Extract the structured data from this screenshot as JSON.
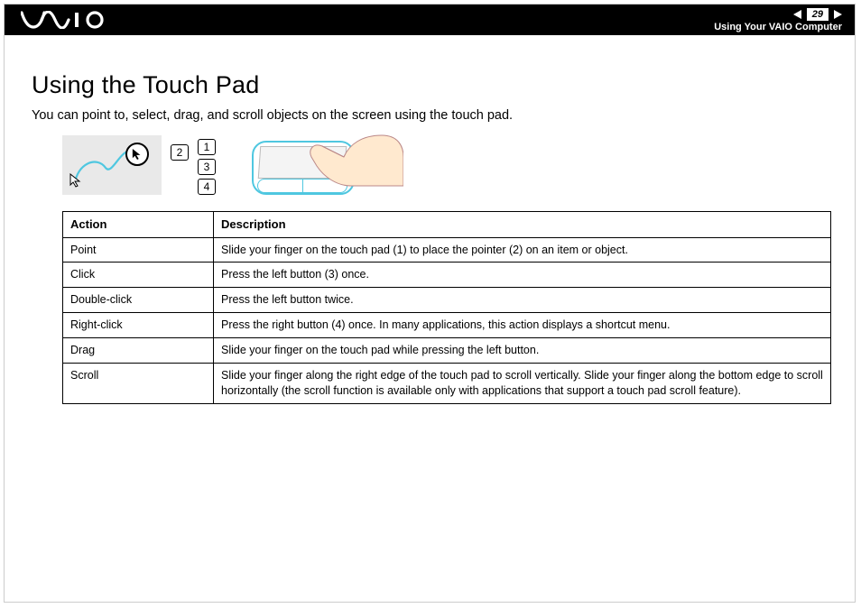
{
  "header": {
    "page_number": "29",
    "section": "Using Your VAIO Computer"
  },
  "title": "Using the Touch Pad",
  "intro": "You can point to, select, drag, and scroll objects on the screen using the touch pad.",
  "callouts": {
    "c1": "1",
    "c2": "2",
    "c3": "3",
    "c4": "4"
  },
  "table": {
    "headers": {
      "action": "Action",
      "description": "Description"
    },
    "rows": [
      {
        "action": "Point",
        "description": "Slide your finger on the touch pad (1) to place the pointer (2) on an item or object."
      },
      {
        "action": "Click",
        "description": "Press the left button (3) once."
      },
      {
        "action": "Double-click",
        "description": "Press the left button twice."
      },
      {
        "action": "Right-click",
        "description": "Press the right button (4) once. In many applications, this action displays a shortcut menu."
      },
      {
        "action": "Drag",
        "description": "Slide your finger on the touch pad while pressing the left button."
      },
      {
        "action": "Scroll",
        "description": "Slide your finger along the right edge of the touch pad to scroll vertically. Slide your finger along the bottom edge to scroll horizontally (the scroll function is available only with applications that support a touch pad scroll feature)."
      }
    ]
  }
}
